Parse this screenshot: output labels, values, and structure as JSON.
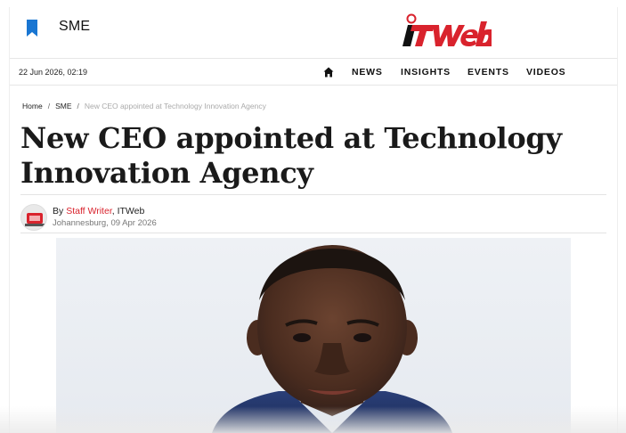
{
  "header": {
    "section_label": "SME",
    "logo_text": "ITWeb"
  },
  "navbar": {
    "datetime": "22 Jun 2026, 02:19",
    "items": [
      "NEWS",
      "INSIGHTS",
      "EVENTS",
      "VIDEOS"
    ]
  },
  "breadcrumb": {
    "home": "Home",
    "section": "SME",
    "current": "New CEO appointed at Technology Innovation Agency",
    "separator": "/"
  },
  "article": {
    "headline_line1": "New CEO appointed at Technology",
    "headline_line2": "Innovation Agency",
    "byline_prefix": "By",
    "author": "Staff Writer",
    "publication": ", ITWeb",
    "dateline": "Johannesburg, 09 Apr 2026"
  },
  "colors": {
    "brand_red": "#d9232d",
    "bookmark_blue": "#1976d2"
  },
  "icons": {
    "section": "bookmark-icon",
    "home": "home-icon"
  }
}
